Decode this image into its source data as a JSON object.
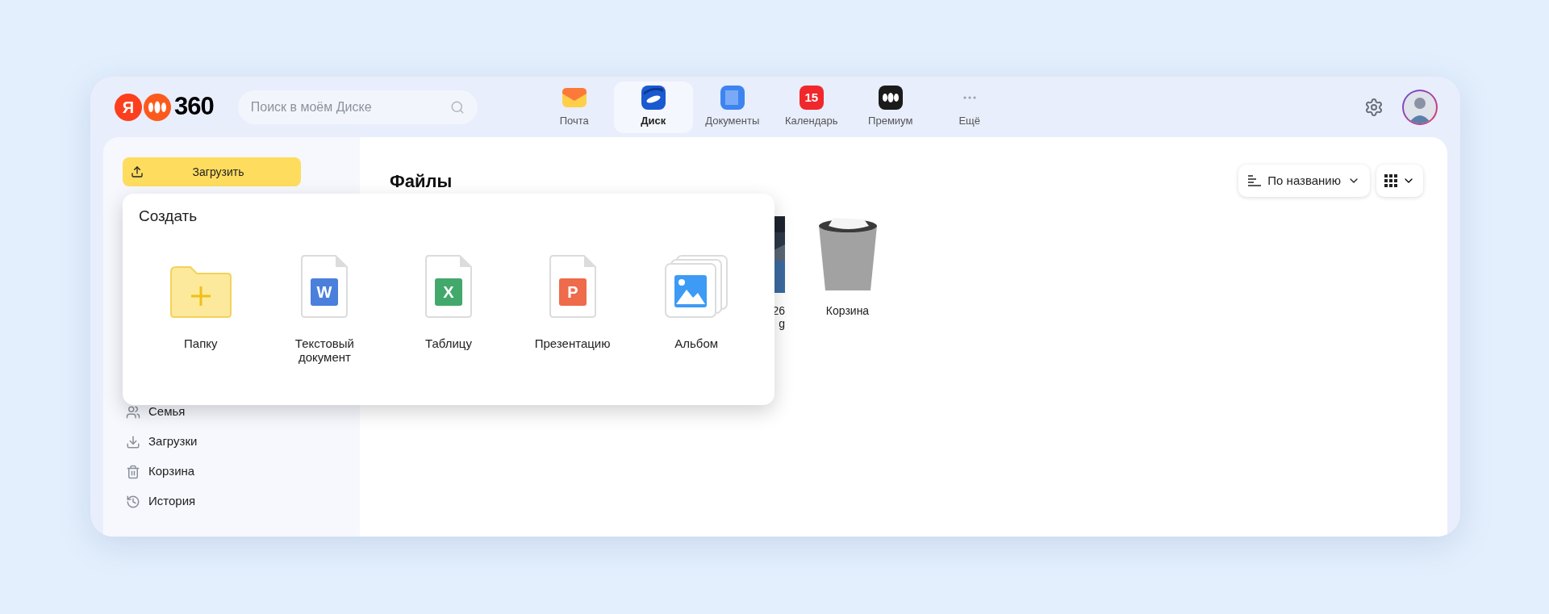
{
  "logo": {
    "letter": "Я",
    "text": "360"
  },
  "search": {
    "placeholder": "Поиск в моём Диске"
  },
  "apps": [
    {
      "label": "Почта",
      "kind": "mail",
      "selected": false
    },
    {
      "label": "Диск",
      "kind": "disk",
      "selected": true
    },
    {
      "label": "Документы",
      "kind": "docs",
      "selected": false
    },
    {
      "label": "Календарь",
      "kind": "calendar",
      "badge": "15",
      "selected": false
    },
    {
      "label": "Премиум",
      "kind": "premium",
      "selected": false
    },
    {
      "label": "Ещё",
      "kind": "more",
      "selected": false
    }
  ],
  "upload_button": {
    "label": "Загрузить"
  },
  "sidebar": {
    "items": [
      {
        "label": "Семья",
        "kind": "family"
      },
      {
        "label": "Загрузки",
        "kind": "downloads"
      },
      {
        "label": "Корзина",
        "kind": "trash"
      },
      {
        "label": "История",
        "kind": "history"
      }
    ]
  },
  "main": {
    "title": "Файлы",
    "sort": {
      "label": "По названию"
    },
    "files": [
      {
        "name_lines": [
          "26",
          "g"
        ]
      },
      {
        "kind": "trash",
        "name_lines": [
          "Корзина"
        ]
      }
    ]
  },
  "create_menu": {
    "title": "Создать",
    "items": [
      {
        "kind": "folder",
        "label": "Папку"
      },
      {
        "kind": "doc",
        "letter": "W",
        "color": "#4a7fdc",
        "label": "Текстовый документ"
      },
      {
        "kind": "doc",
        "letter": "X",
        "color": "#43a86b",
        "label": "Таблицу"
      },
      {
        "kind": "doc",
        "letter": "P",
        "color": "#ee6b4b",
        "label": "Презентацию"
      },
      {
        "kind": "album",
        "label": "Альбом"
      }
    ]
  }
}
